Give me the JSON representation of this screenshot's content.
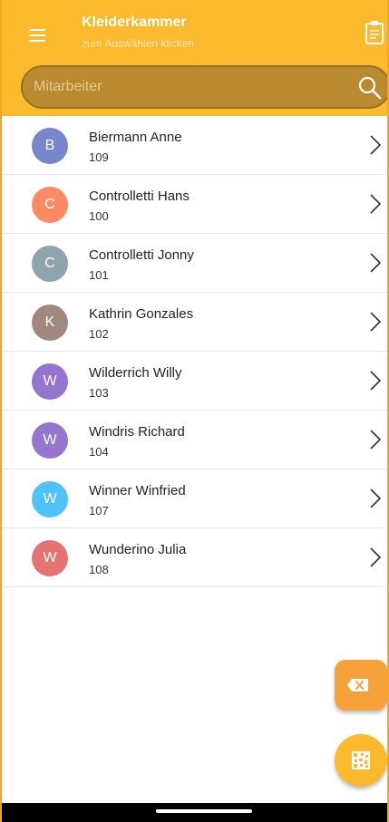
{
  "app_bar": {
    "title": "Kleiderkammer",
    "subtitle": "zum Auswählen klicken",
    "menu_icon": "hamburger-menu-icon",
    "clipboard_icon": "clipboard-icon",
    "background_color": "#fbb92e"
  },
  "search": {
    "placeholder": "Mitarbeiter",
    "value": "",
    "icon": "search-icon"
  },
  "employees": [
    {
      "initial": "B",
      "name": "Biermann Anne",
      "number": "109",
      "color": "#7986cb"
    },
    {
      "initial": "C",
      "name": "Controlletti Hans",
      "number": "100",
      "color": "#ff8a65"
    },
    {
      "initial": "C",
      "name": "Controlletti Jonny",
      "number": "101",
      "color": "#90a4ae"
    },
    {
      "initial": "K",
      "name": "Kathrin Gonzales",
      "number": "102",
      "color": "#a1887f"
    },
    {
      "initial": "W",
      "name": "Wilderrich Willy",
      "number": "103",
      "color": "#9575cd"
    },
    {
      "initial": "W",
      "name": "Windris Richard",
      "number": "104",
      "color": "#9575cd"
    },
    {
      "initial": "W",
      "name": "Winner Winfried",
      "number": "107",
      "color": "#4fc3f7"
    },
    {
      "initial": "W",
      "name": "Wunderino Julia",
      "number": "108",
      "color": "#e57373"
    }
  ],
  "fab": {
    "clear_icon": "backspace-icon",
    "clear_color": "#f7a13b",
    "scan_icon": "qr-code-icon",
    "scan_color": "#fbb92e"
  }
}
